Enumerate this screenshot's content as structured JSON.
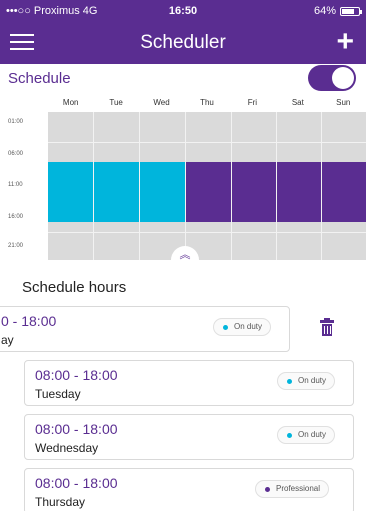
{
  "status": {
    "carrier": "•••○○ Proximus  4G",
    "time": "16:50",
    "battery": "64%"
  },
  "nav": {
    "title": "Scheduler",
    "menu_icon": "hamburger-icon",
    "add_icon": "plus-icon"
  },
  "schedule_toggle": {
    "label": "Schedule",
    "on": true
  },
  "calendar": {
    "days": [
      "Mon",
      "Tue",
      "Wed",
      "Thu",
      "Fri",
      "Sat",
      "Sun"
    ],
    "hours": [
      "01:00",
      "06:00",
      "11:00",
      "16:00",
      "21:00"
    ],
    "colors": {
      "on_duty": "#00b5dc",
      "professional": "#5a2d91",
      "empty": "#dadada"
    }
  },
  "schedule_hours": {
    "title": "Schedule hours",
    "items": [
      {
        "time": "0 - 18:00",
        "day": "ay",
        "status": "On duty"
      },
      {
        "time": "08:00 - 18:00",
        "day": "Tuesday",
        "status": "On duty"
      },
      {
        "time": "08:00 - 18:00",
        "day": "Wednesday",
        "status": "On duty"
      },
      {
        "time": "08:00 - 18:00",
        "day": "Thursday",
        "status": "Professional"
      }
    ]
  }
}
